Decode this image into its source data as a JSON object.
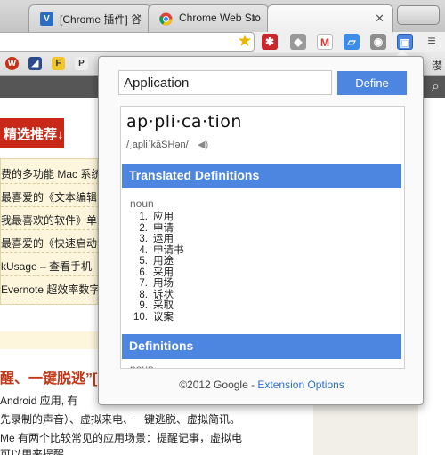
{
  "tabs": [
    {
      "title": "[Chrome 插件] 谷",
      "favicon": "V"
    },
    {
      "title": "Chrome Web Sto",
      "favicon": "chrome-store"
    }
  ],
  "bookmarks": {
    "trailing_text": "漤"
  },
  "page": {
    "banner": "精选推荐↓",
    "list_items": [
      "费的多功能 Mac 系统",
      "最喜爱的《文本编辑",
      "我最喜欢的软件》单",
      "最喜爱的《快速启动",
      "kUsage – 查看手机",
      "Evernote 超效率数字"
    ],
    "heading": "醒、一键脱逃”[",
    "lines": [
      "Android 应用, 有",
      "先录制的声音）、虚拟来电、一键逃脱、虚拟简讯。",
      "Me  有两个比较常见的应用场景：提醒记事，虚拟电",
      "可以用来提醒"
    ]
  },
  "popup": {
    "search_value": "Application",
    "define_label": "Define",
    "headword": "ap·pli·ca·tion",
    "phonetic": "/ˌapliˈkāSHən/",
    "translated_title": "Translated Definitions",
    "pos": "noun",
    "definitions": [
      "应用",
      "申请",
      "运用",
      "申请书",
      "用途",
      "采用",
      "用场",
      "诉状",
      "采取",
      "议案"
    ],
    "definitions_title": "Definitions",
    "pos2": "noun",
    "footer_text": "©2012 Google - ",
    "footer_link": "Extension Options"
  },
  "colors": {
    "accent": "#4d86e0",
    "banner": "#c82818",
    "link": "#2f6fc8"
  }
}
